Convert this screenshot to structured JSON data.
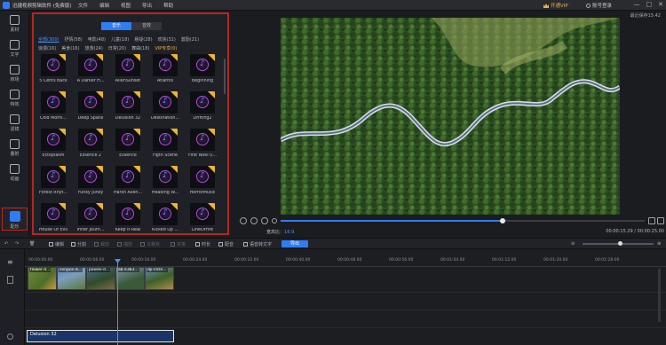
{
  "app": {
    "title": "迅捷视频剪辑软件 (免费版)"
  },
  "menu": [
    "文件",
    "编辑",
    "视图",
    "导出",
    "帮助"
  ],
  "account": {
    "vip_label": "开通VIP",
    "login_label": "账号登录"
  },
  "window_buttons": [
    "—",
    "□",
    "✕"
  ],
  "sidebar": [
    {
      "label": "素材",
      "icon": "media-icon",
      "active": false
    },
    {
      "label": "文字",
      "icon": "text-icon",
      "active": false
    },
    {
      "label": "转场",
      "icon": "transition-icon",
      "active": false
    },
    {
      "label": "特效",
      "icon": "effects-icon",
      "active": false
    },
    {
      "label": "滤镜",
      "icon": "filter-icon",
      "active": false
    },
    {
      "label": "叠附",
      "icon": "overlay-icon",
      "active": false
    },
    {
      "label": "动画",
      "icon": "animation-icon",
      "active": false
    },
    {
      "label": "配乐",
      "icon": "music-icon",
      "active": true
    }
  ],
  "library": {
    "tabs": [
      {
        "label": "音乐",
        "active": true
      },
      {
        "label": "音效",
        "active": false
      }
    ],
    "categories_row1": [
      "全部(300)",
      "抒情(58)",
      "电影(48)",
      "儿童(18)",
      "悬疑(28)",
      "欢快(31)",
      "激励(21)"
    ],
    "categories_row2": [
      "浪漫(16)",
      "美食(16)",
      "旅游(24)",
      "日常(20)",
      "舞曲(18)",
      "VIP专享(0)"
    ],
    "tracks": [
      "5 Cents Back",
      "A Darker H...",
      "AlienSunset",
      "Atlantis",
      "Beginning",
      "Cold Morni...",
      "Deep Space",
      "Delusion 32",
      "Destination...",
      "Drifting2",
      "Ectoplasm",
      "Essence 2",
      "Essence",
      "Figth Scene",
      "First Noel (I...",
      "Forest Rhyt...",
      "Funky Junky",
      "Harsh Alien...",
      "Heading W...",
      "HorrorMusic",
      "House Of Evil",
      "Inner Journ...",
      "Keep It Real",
      "Kicked Up ...",
      "LineOfFire"
    ]
  },
  "preview": {
    "ratio_label": "最近保存15:42",
    "aspect_label": "宽高比：",
    "aspect_value": "16:9",
    "time": "00:00:15.29 / 00:00:25.00",
    "progress": 0.61
  },
  "toolbar": {
    "undo": "↶",
    "redo": "↷",
    "delete": "🗑",
    "items": [
      {
        "label": "编辑",
        "dim": false
      },
      {
        "label": "分割",
        "dim": false
      },
      {
        "label": "裁剪",
        "dim": true
      },
      {
        "label": "缩放",
        "dim": true
      },
      {
        "label": "马赛克",
        "dim": true
      },
      {
        "label": "定格",
        "dim": true
      },
      {
        "label": "时长",
        "dim": false
      },
      {
        "label": "配音",
        "dim": false
      },
      {
        "label": "语音转文字",
        "dim": false
      }
    ],
    "export": "导出"
  },
  "timeline": {
    "ticks": [
      "00:00:00.00",
      "00:00:08.00",
      "00:00:16.00",
      "00:00:24.00",
      "00:00:32.00",
      "00:00:40.00",
      "00:00:48.00",
      "00:00:56.00",
      "00:01:04.00",
      "00:01:12.00",
      "00:01:20.00",
      "00:01:28.00"
    ],
    "clips": [
      "flower-4...",
      "sergios-d...",
      "pexels-d...",
      "ab e3b3...",
      "drone-...",
      "dji-clcle..."
    ],
    "audio_clip": "Delusion 32"
  }
}
